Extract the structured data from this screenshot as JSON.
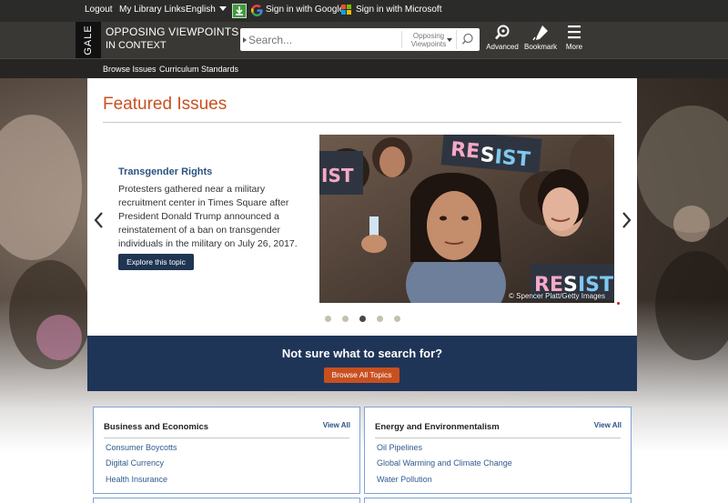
{
  "topbar": {
    "logout": "Logout",
    "my_library_links": "My Library Links",
    "language": "English",
    "google_signin": "Sign in with Google",
    "microsoft_signin": "Sign in with Microsoft"
  },
  "header": {
    "brand": "GALE",
    "product_line1": "OPPOSING VIEWPOINTS",
    "product_line2": "IN CONTEXT",
    "search_placeholder": "Search...",
    "scope_line1": "Opposing",
    "scope_line2": "Viewpoints",
    "advanced": "Advanced",
    "bookmark": "Bookmark",
    "more": "More"
  },
  "subnav": {
    "browse_issues": "Browse Issues",
    "curriculum_standards": "Curriculum Standards"
  },
  "featured": {
    "title": "Featured Issues",
    "topic_title": "Transgender Rights",
    "topic_desc": "Protesters gathered near a military recruitment center in Times Square after President Donald Trump announced a reinstatement of a ban on transgender individuals in the military on July 26, 2017.",
    "explore_label": "Explore this topic",
    "photo_credit": "© Spencer Platt/Getty Images",
    "sign_text": "RESIST",
    "slide_count": 5,
    "active_slide": 3
  },
  "band": {
    "title": "Not sure what to search for?",
    "button": "Browse All Topics"
  },
  "categories": [
    {
      "title": "Business and Economics",
      "view_all": "View All",
      "items": [
        "Consumer Boycotts",
        "Digital Currency",
        "Health Insurance"
      ]
    },
    {
      "title": "Energy and Environmentalism",
      "view_all": "View All",
      "items": [
        "Oil Pipelines",
        "Global Warming and Climate Change",
        "Water Pollution"
      ]
    }
  ],
  "colors": {
    "accent_orange": "#c8501f",
    "navy": "#1f3557",
    "link_blue": "#2c5282"
  }
}
